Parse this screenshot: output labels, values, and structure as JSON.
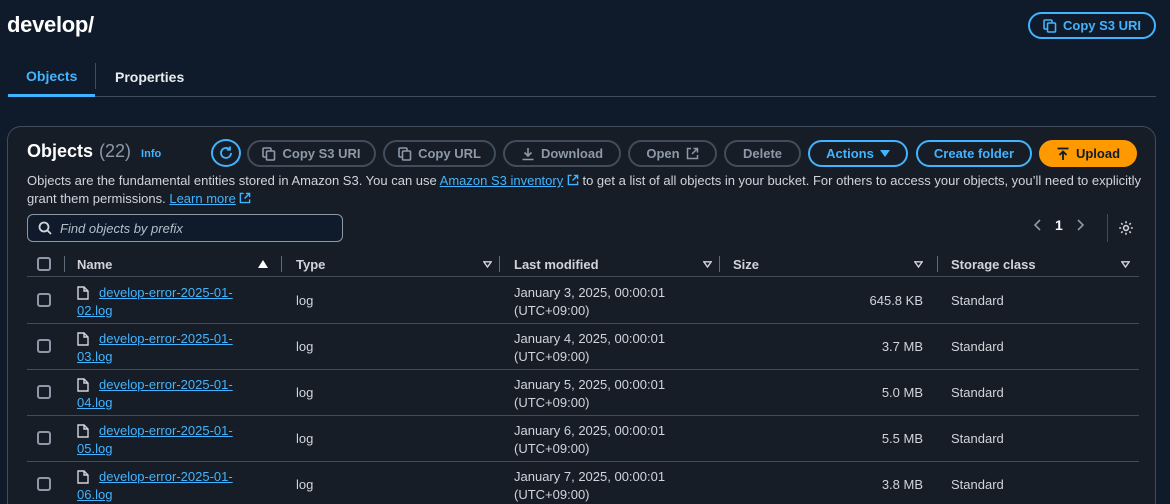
{
  "header": {
    "title": "develop/",
    "copy_s3_uri": "Copy S3 URI"
  },
  "tabs": [
    {
      "label": "Objects",
      "active": true
    },
    {
      "label": "Properties",
      "active": false
    }
  ],
  "panel": {
    "title": "Objects",
    "count": "(22)",
    "info": "Info",
    "toolbar": {
      "copy_s3_uri": "Copy S3 URI",
      "copy_url": "Copy URL",
      "download": "Download",
      "open": "Open",
      "delete": "Delete",
      "actions": "Actions",
      "create_folder": "Create folder",
      "upload": "Upload"
    },
    "description": {
      "part1": "Objects are the fundamental entities stored in Amazon S3. You can use ",
      "inventory_link": "Amazon S3 inventory",
      "part2": " to get a list of all objects in your bucket. For others to access your objects, you’ll need to explicitly grant them permissions. ",
      "learn_more": "Learn more"
    },
    "search": {
      "placeholder": "Find objects by prefix",
      "value": ""
    },
    "pagination": {
      "current_page": "1"
    },
    "columns": {
      "name": "Name",
      "type": "Type",
      "last_modified": "Last modified",
      "size": "Size",
      "storage_class": "Storage class"
    },
    "rows": [
      {
        "name_line1": "develop-error-2025-01-",
        "name_line2": "02.log",
        "type": "log",
        "modified_line1": "January 3, 2025, 00:00:01",
        "modified_line2": "(UTC+09:00)",
        "size": "645.8 KB",
        "storage_class": "Standard"
      },
      {
        "name_line1": "develop-error-2025-01-",
        "name_line2": "03.log",
        "type": "log",
        "modified_line1": "January 4, 2025, 00:00:01",
        "modified_line2": "(UTC+09:00)",
        "size": "3.7 MB",
        "storage_class": "Standard"
      },
      {
        "name_line1": "develop-error-2025-01-",
        "name_line2": "04.log",
        "type": "log",
        "modified_line1": "January 5, 2025, 00:00:01",
        "modified_line2": "(UTC+09:00)",
        "size": "5.0 MB",
        "storage_class": "Standard"
      },
      {
        "name_line1": "develop-error-2025-01-",
        "name_line2": "05.log",
        "type": "log",
        "modified_line1": "January 6, 2025, 00:00:01",
        "modified_line2": "(UTC+09:00)",
        "size": "5.5 MB",
        "storage_class": "Standard"
      },
      {
        "name_line1": "develop-error-2025-01-",
        "name_line2": "06.log",
        "type": "log",
        "modified_line1": "January 7, 2025, 00:00:01",
        "modified_line2": "(UTC+09:00)",
        "size": "3.8 MB",
        "storage_class": "Standard"
      }
    ]
  },
  "colors": {
    "accent": "#42b4ff",
    "upload": "#ff9900",
    "background": "#0f1b2a",
    "panel": "#161d26"
  },
  "icons": [
    "copy-icon",
    "refresh-icon",
    "download-icon",
    "external-link-icon",
    "caret-down-icon",
    "upload-icon",
    "search-icon",
    "chevron-left-icon",
    "chevron-right-icon",
    "gear-icon",
    "sort-up-icon",
    "sort-down-icon",
    "file-icon"
  ]
}
